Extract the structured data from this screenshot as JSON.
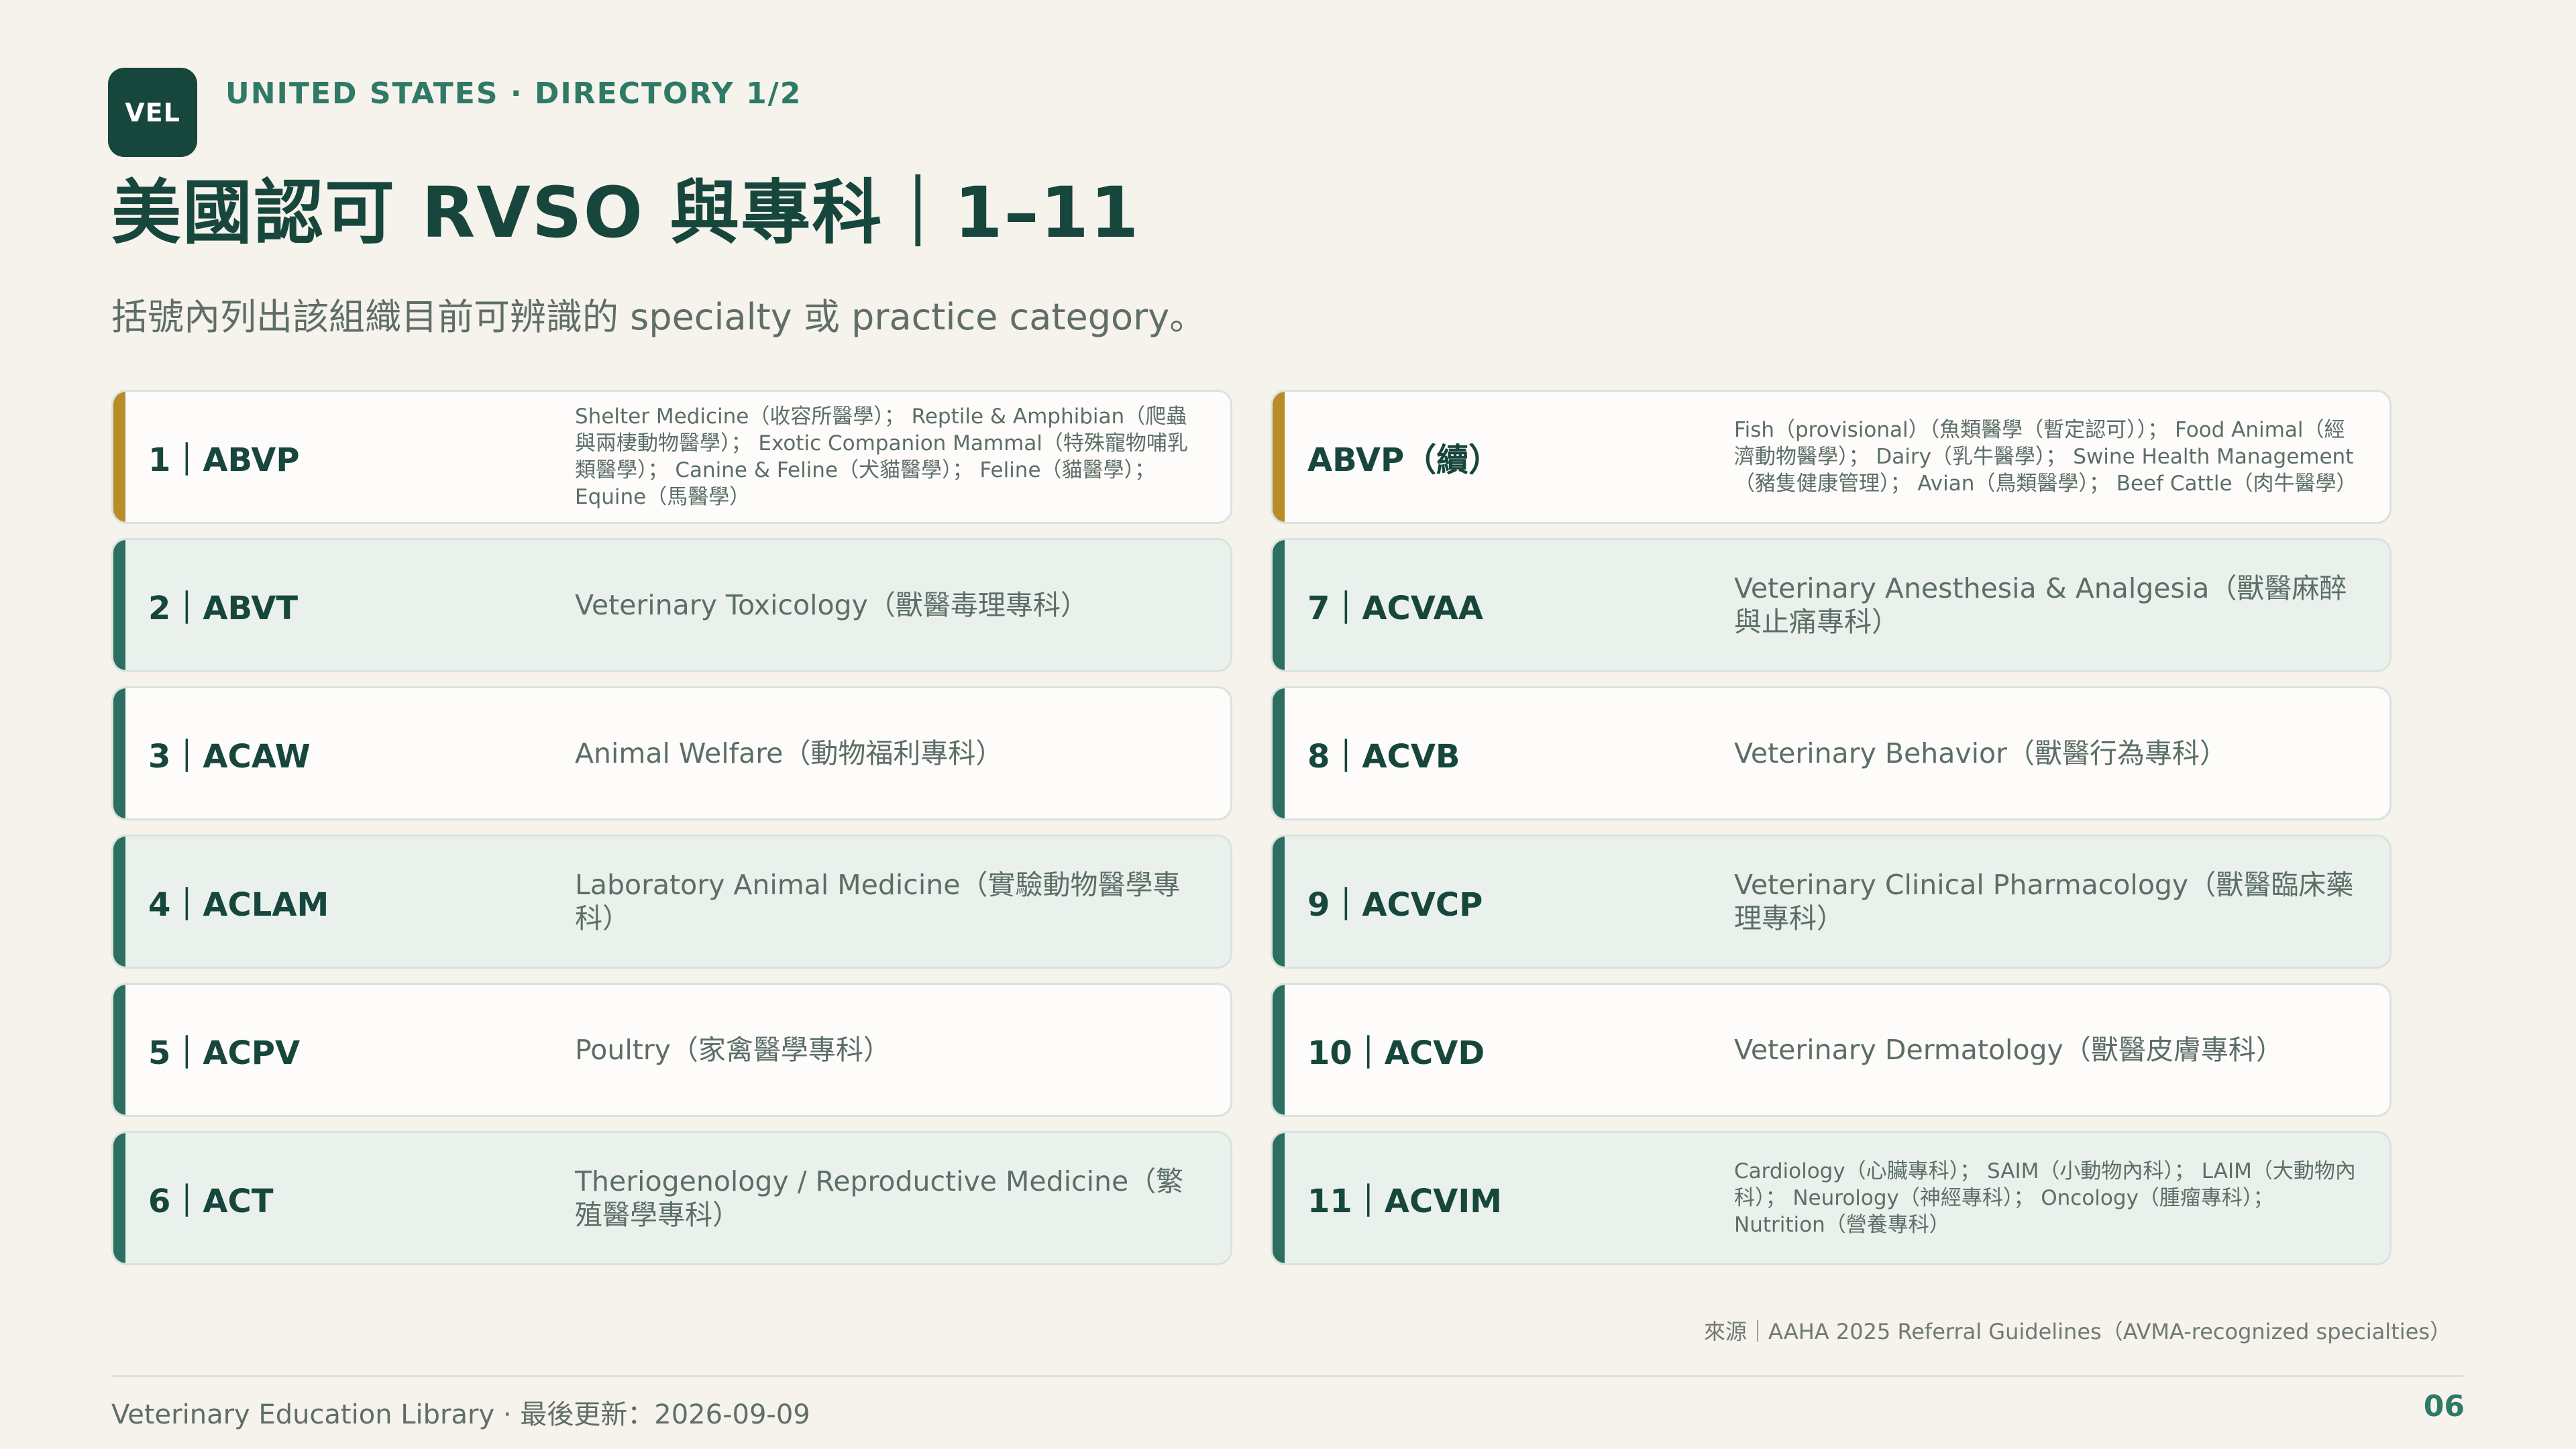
{
  "header": {
    "logo_text": "VEL",
    "eyebrow": "UNITED STATES · DIRECTORY 1/2",
    "title": "美國認可 RVSO 與專科｜1–11",
    "subtitle": "括號內列出該組織目前可辨識的 specialty 或 practice category。"
  },
  "cards_left": [
    {
      "code": "1｜ABVP",
      "desc": "Shelter Medicine（收容所醫學）； Reptile & Amphibian（爬蟲與兩棲動物醫學）； Exotic Companion Mammal（特殊寵物哺乳類醫學）； Canine & Feline（犬貓醫學）； Feline（貓醫學）； Equine（馬醫學）"
    },
    {
      "code": "2｜ABVT",
      "desc": "Veterinary Toxicology（獸醫毒理專科）"
    },
    {
      "code": "3｜ACAW",
      "desc": "Animal Welfare（動物福利專科）"
    },
    {
      "code": "4｜ACLAM",
      "desc": "Laboratory Animal Medicine（實驗動物醫學專科）"
    },
    {
      "code": "5｜ACPV",
      "desc": "Poultry（家禽醫學專科）"
    },
    {
      "code": "6｜ACT",
      "desc": "Theriogenology / Reproductive Medicine（繁殖醫學專科）"
    }
  ],
  "cards_right": [
    {
      "code": "ABVP（續）",
      "desc": "Fish（provisional）（魚類醫學（暫定認可））； Food Animal（經濟動物醫學）； Dairy（乳牛醫學）； Swine Health Management（豬隻健康管理）； Avian（鳥類醫學）； Beef Cattle（肉牛醫學）"
    },
    {
      "code": "7｜ACVAA",
      "desc": "Veterinary Anesthesia & Analgesia（獸醫麻醉與止痛專科）"
    },
    {
      "code": "8｜ACVB",
      "desc": "Veterinary Behavior（獸醫行為專科）"
    },
    {
      "code": "9｜ACVCP",
      "desc": "Veterinary Clinical Pharmacology（獸醫臨床藥理專科）"
    },
    {
      "code": "10｜ACVD",
      "desc": "Veterinary Dermatology（獸醫皮膚專科）"
    },
    {
      "code": "11｜ACVIM",
      "desc": "Cardiology（心臟專科）； SAIM（小動物內科）； LAIM（大動物內科）； Neurology（神經專科）； Oncology（腫瘤專科）； Nutrition（營養專科）"
    }
  ],
  "source": "來源｜AAHA 2025 Referral Guidelines（AVMA-recognized specialties）",
  "footer": {
    "left": "Veterinary Education Library · 最後更新：2026-09-09",
    "page_number": "06"
  },
  "colors": {
    "background": "#f6f2ec",
    "primary": "#17463c",
    "accent_teal": "#2c6e60",
    "accent_gold": "#b88c27"
  }
}
